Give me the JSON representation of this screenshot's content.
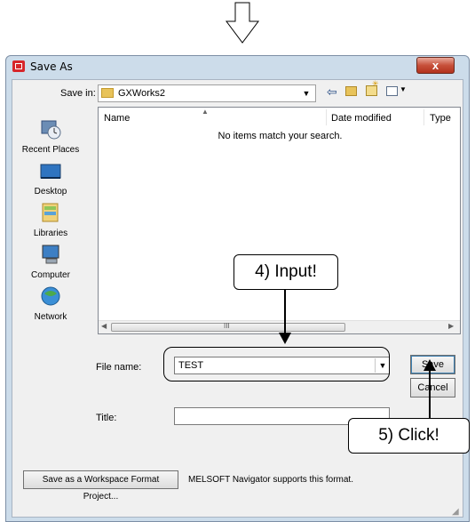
{
  "dialog": {
    "title": "Save As",
    "close_glyph": "x"
  },
  "toolbar": {
    "save_in_label": "Save in:",
    "save_in_value": "GXWorks2",
    "back_glyph": "⇦"
  },
  "places": {
    "recent": "Recent Places",
    "desktop": "Desktop",
    "libraries": "Libraries",
    "computer": "Computer",
    "network": "Network"
  },
  "file_list": {
    "columns": [
      "Name",
      "Date modified",
      "Type"
    ],
    "empty_message": "No items match your search.",
    "scroll_grip": "III"
  },
  "form": {
    "filename_label": "File name:",
    "filename_value": "TEST",
    "title_label": "Title:",
    "title_value": "",
    "save_label": "Save",
    "cancel_label": "Cancel"
  },
  "bottom": {
    "workspace_button": "Save as a Workspace Format Project...",
    "navigator_note": "MELSOFT Navigator supports this format."
  },
  "callouts": {
    "input": "4) Input!",
    "click": "5) Click!"
  },
  "colors": {
    "title_bar": "#ccdcea",
    "close_button": "#c7503a",
    "folder": "#e8c35a"
  }
}
